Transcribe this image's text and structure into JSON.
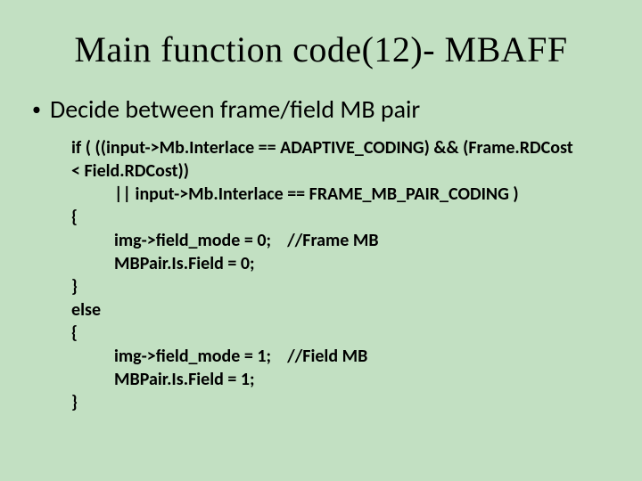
{
  "title": "Main function code(12)- MBAFF",
  "bullet": "Decide between frame/field MB pair",
  "code": {
    "l0": "if ( ((input->Mb.Interlace == ADAPTIVE_CODING) && (Frame.RDCost",
    "l1": "< Field.RDCost))",
    "l2": "|| input->Mb.Interlace == FRAME_MB_PAIR_CODING )",
    "l3": "{",
    "l4": "img->field_mode = 0;    //Frame MB",
    "l5": "MBPair.Is.Field = 0;",
    "l6": "}",
    "l7": "else",
    "l8": "{",
    "l9": "img->field_mode = 1;    //Field MB",
    "l10": "MBPair.Is.Field = 1;",
    "l11": "}"
  }
}
